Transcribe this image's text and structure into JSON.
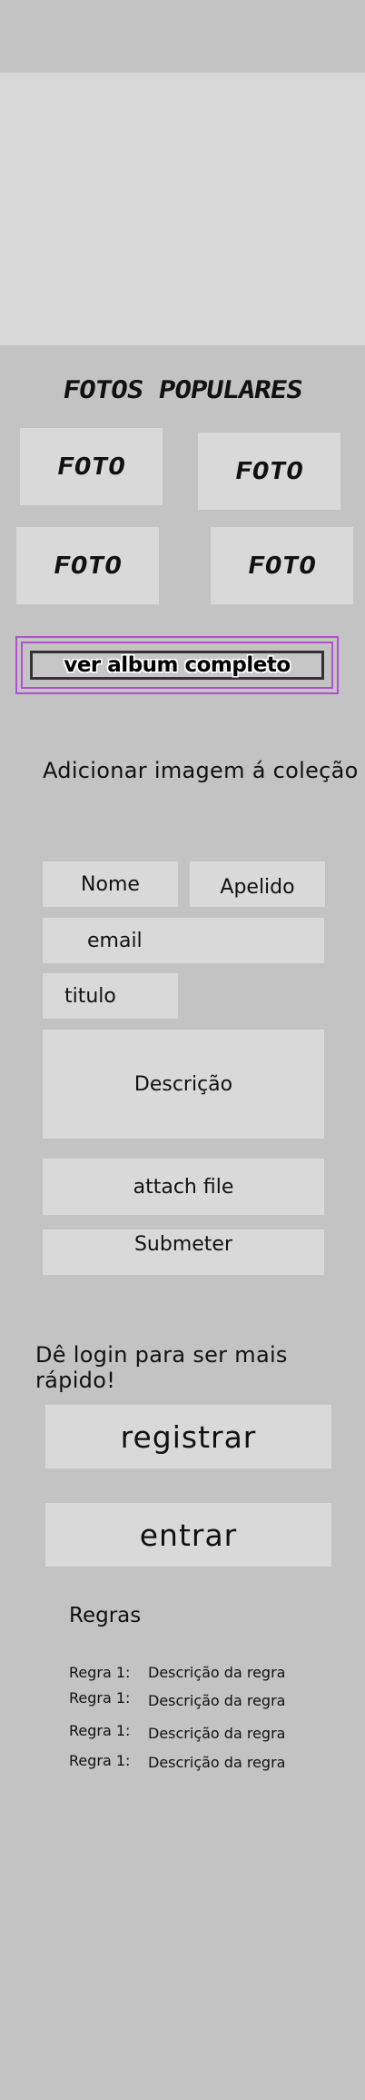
{
  "gallery": {
    "title": "FOTOS POPULARES",
    "photos": [
      "FOTO",
      "FOTO",
      "FOTO",
      "FOTO"
    ],
    "album_button": "ver album completo",
    "accent_color": "#b24fd0"
  },
  "form": {
    "heading": "Adicionar imagem á coleção",
    "nome": "Nome",
    "apelido": "Apelido",
    "email": "email",
    "titulo": "titulo",
    "descricao": "Descrição",
    "attach": "attach file",
    "submit": "Submeter"
  },
  "login": {
    "heading": "Dê login para ser mais rápido!",
    "register": "registrar",
    "enter": "entrar"
  },
  "rules": {
    "title": "Regras",
    "items": [
      {
        "label": "Regra 1:",
        "desc": "Descrição da regra"
      },
      {
        "label": "Regra 1:",
        "desc": "Descrição da regra"
      },
      {
        "label": "Regra 1:",
        "desc": "Descrição da regra"
      },
      {
        "label": "Regra 1:",
        "desc": "Descrição da regra"
      }
    ]
  }
}
